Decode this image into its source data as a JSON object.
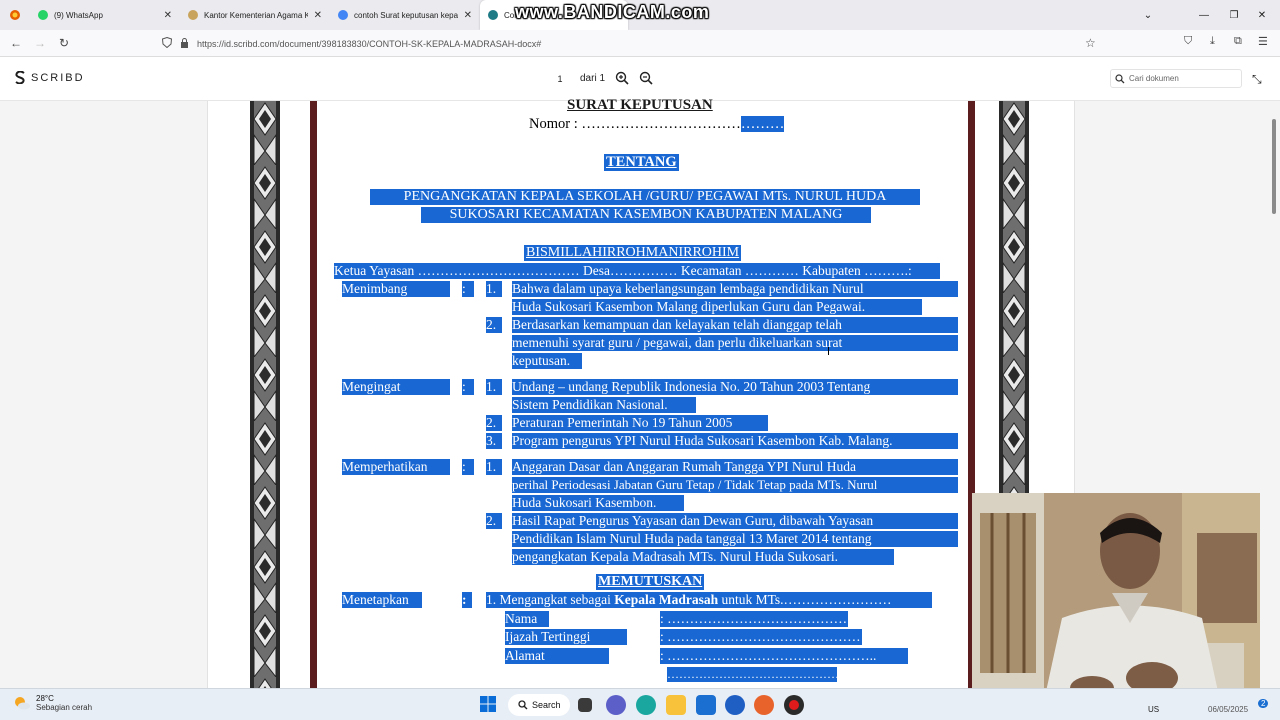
{
  "browser": {
    "tabs": [
      {
        "label": "(9) WhatsApp",
        "color": "#25d366"
      },
      {
        "label": "Kantor Kementerian Agama Kab",
        "color": "#c8a35c"
      },
      {
        "label": "contoh Surat keputusan kepala",
        "color": "#4285f4"
      },
      {
        "label": "Contoh SK",
        "color": "#1e7b85"
      }
    ],
    "recorder_watermark": "www.BANDICAM.com",
    "url": "https://id.scribd.com/document/398183830/CONTOH-SK-KEPALA-MADRASAH-docx#"
  },
  "scribd": {
    "logo_text": "SCRIBD",
    "page_current": "1",
    "page_of": "dari 1",
    "search_placeholder": "Cari dokumen",
    "brand_color": "#1e7b85"
  },
  "document": {
    "title": "SURAT KEPUTUSAN",
    "nomor_label": "Nomor : ",
    "nomor_dots": "……………………………",
    "nomor_dots_sel": "………",
    "tentang": "TENTANG",
    "subject_1": "PENGANGKATAN KEPALA SEKOLAH /GURU/ PEGAWAI MTs. NURUL HUDA",
    "subject_2": "SUKOSARI KECAMATAN KASEMBON KABUPATEN MALANG",
    "bismillah": "BISMILLAHIRROHMANIRROHIM",
    "ketua": "Ketua Yayasan ……………………………… Desa…………… Kecamatan ………… Kabupaten ……….:",
    "menimbang": {
      "label": "Menimbang",
      "items": [
        {
          "num": "1.",
          "lines": [
            "Bahwa dalam upaya keberlangsungan lembaga pendidikan Nurul",
            "Huda Sukosari Kasembon Malang diperlukan Guru dan Pegawai."
          ]
        },
        {
          "num": "2.",
          "lines": [
            "Berdasarkan kemampuan dan kelayakan telah dianggap telah",
            "memenuhi syarat guru / pegawai, dan perlu dikeluarkan surat",
            "keputusan."
          ]
        }
      ]
    },
    "mengingat": {
      "label": "Mengingat",
      "items": [
        {
          "num": "1.",
          "lines": [
            "Undang – undang Republik Indonesia No. 20 Tahun 2003 Tentang",
            "Sistem Pendidikan Nasional."
          ]
        },
        {
          "num": "2.",
          "lines": [
            "Peraturan Pemerintah No 19 Tahun 2005"
          ]
        },
        {
          "num": "3.",
          "lines": [
            "Program pengurus YPI Nurul Huda Sukosari Kasembon Kab. Malang."
          ]
        }
      ]
    },
    "memperhatikan": {
      "label": "Memperhatikan",
      "items": [
        {
          "num": "1.",
          "lines": [
            "Anggaran Dasar dan Anggaran Rumah Tangga YPI Nurul Huda",
            "perihal Periodesasi Jabatan Guru Tetap / Tidak Tetap pada MTs. Nurul",
            "Huda Sukosari Kasembon."
          ]
        },
        {
          "num": "2.",
          "lines": [
            "Hasil Rapat Pengurus Yayasan dan Dewan Guru, dibawah Yayasan",
            "Pendidikan Islam Nurul Huda pada tanggal 13 Maret 2014 tentang",
            "pengangkatan Kepala Madrasah MTs. Nurul Huda Sukosari."
          ]
        }
      ]
    },
    "memutuskan": "MEMUTUSKAN",
    "menetapkan": {
      "label": "Menetapkan",
      "colon": ":",
      "item_pre": "1. Mengangkat sebagai ",
      "item_bold": "Kepala Madrasah",
      "item_post": " untuk MTs.……………………"
    },
    "fields": [
      {
        "label": "Nama",
        "value": ": ………………………………………"
      },
      {
        "label": "Ijazah Tertinggi",
        "value": ": ……………………………………….."
      },
      {
        "label": "Alamat",
        "value": ": ……………………………………….."
      }
    ],
    "extra_dots": "………………………………………"
  },
  "taskbar": {
    "temperature": "28°C",
    "weather": "Sebagian cerah",
    "search_label": "Search",
    "tray_lang": "US",
    "tray_date": "06/05/2025",
    "notif_count": "2"
  }
}
